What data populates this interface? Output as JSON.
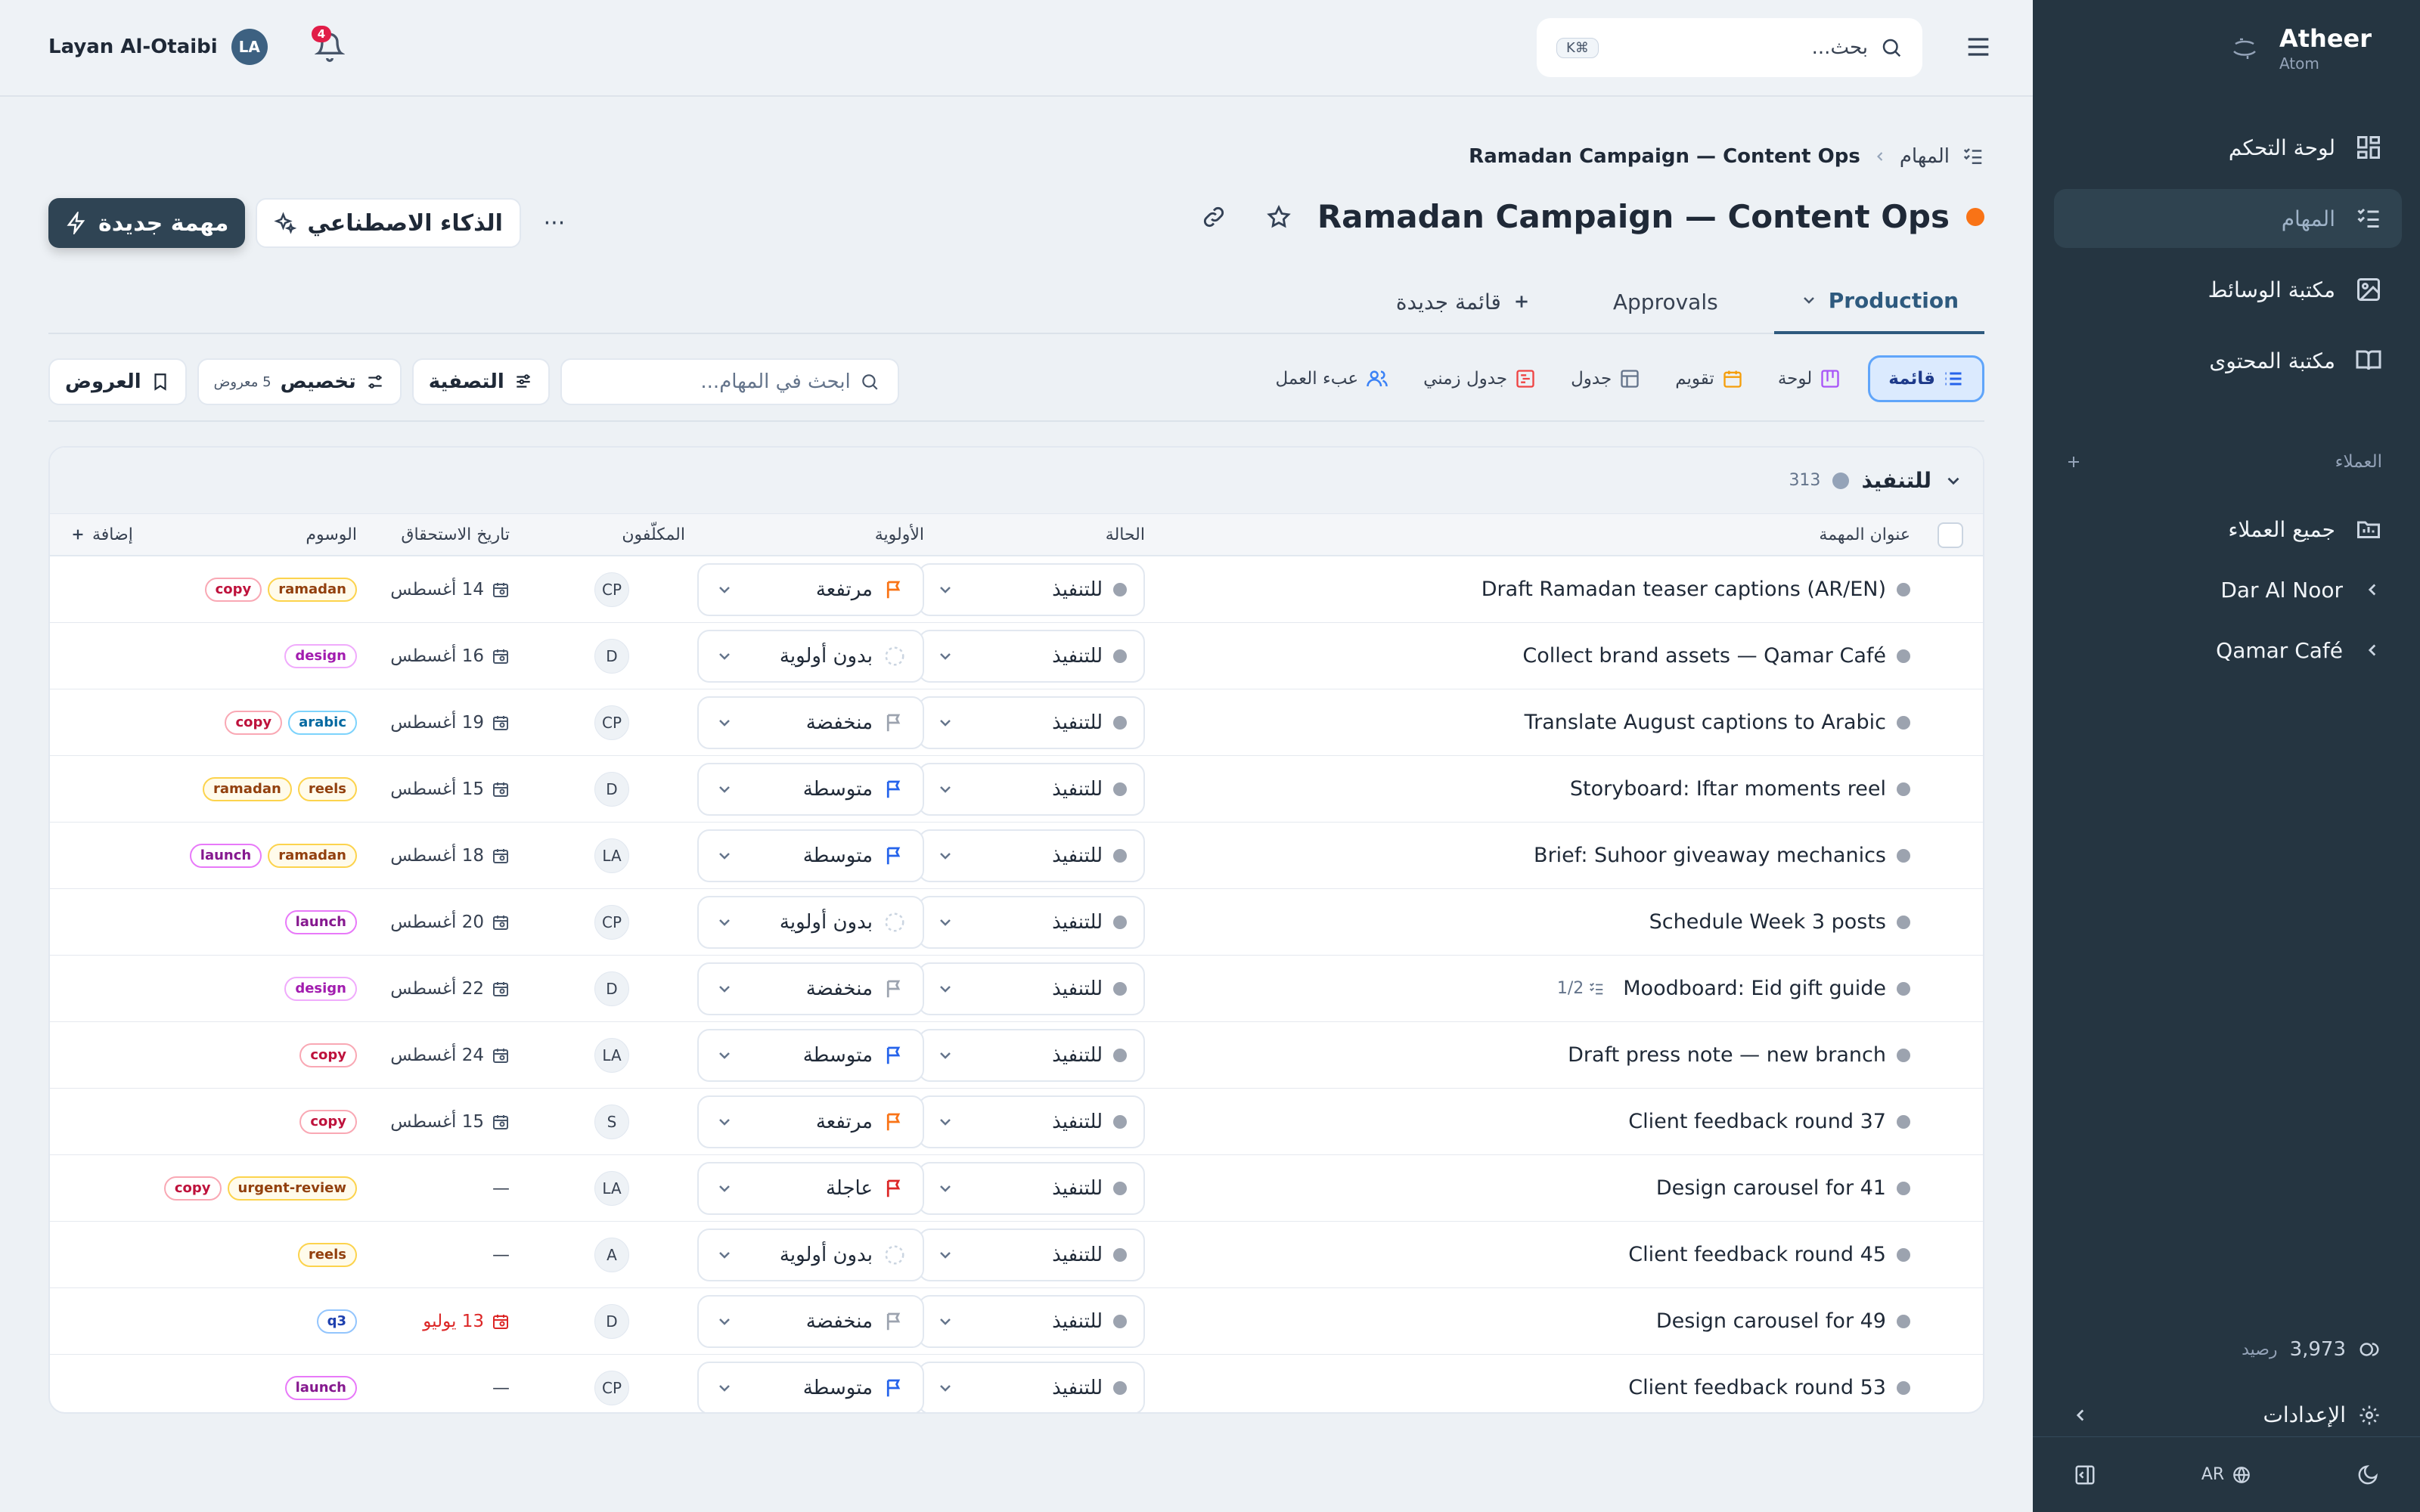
{
  "sidebar": {
    "brand": "Atheer",
    "brand_sub": "Atom",
    "items": [
      {
        "label": "لوحة التحكم"
      },
      {
        "label": "المهام"
      },
      {
        "label": "مكتبة الوسائط"
      },
      {
        "label": "مكتبة المحتوى"
      }
    ],
    "clients_heading": "العملاء",
    "clients": [
      {
        "label": "جميع العملاء"
      },
      {
        "label": "Dar Al Noor"
      },
      {
        "label": "Qamar Café"
      }
    ],
    "credits_value": "3,973",
    "credits_label": "رصيد",
    "settings_label": "الإعدادات",
    "lang": "AR"
  },
  "topbar": {
    "search_placeholder": "بحث...",
    "search_kbd": "⌘K",
    "user_name": "Layan Al-Otaibi",
    "user_initials": "LA",
    "notif_count": "4"
  },
  "breadcrumb": {
    "root": "المهام",
    "current": "Ramadan Campaign — Content Ops"
  },
  "page": {
    "title": "Ramadan Campaign — Content Ops",
    "new_task": "مهمة جديدة",
    "ai": "الذكاء الاصطناعي",
    "more": "···"
  },
  "tabs": [
    {
      "label": "Production"
    },
    {
      "label": "Approvals"
    },
    {
      "label": "قائمة جديدة"
    }
  ],
  "views": [
    {
      "label": "قائمة"
    },
    {
      "label": "لوحة"
    },
    {
      "label": "تقويم"
    },
    {
      "label": "جدول"
    },
    {
      "label": "جدول زمني"
    },
    {
      "label": "عبء العمل"
    }
  ],
  "toolbar": {
    "search_placeholder": "ابحث في المهام...",
    "filter": "التصفية",
    "customize": "تخصيص",
    "customize_count": "5 معروض",
    "views": "العروض"
  },
  "group": {
    "name": "للتنفيذ",
    "count": "313"
  },
  "columns": {
    "title": "عنوان المهمة",
    "status": "الحالة",
    "priority": "الأولوية",
    "assignees": "المكلّفون",
    "due": "تاريخ الاستحقاق",
    "tags": "الوسوم",
    "add": "إضافة"
  },
  "colors": {
    "high": "#f97316",
    "none": "#cbd5e1",
    "low": "#9ca3af",
    "medium": "#2563eb",
    "urgent": "#dc2626"
  },
  "rows": [
    {
      "title": "Draft Ramadan teaser captions (AR/EN)",
      "status": "للتنفيذ",
      "priority": "مرتفعة",
      "p": "high",
      "assignee": "CP",
      "due": "14 أغسطس",
      "tags": [
        "ramadan",
        "copy"
      ]
    },
    {
      "title": "Collect brand assets — Qamar Café",
      "status": "للتنفيذ",
      "priority": "بدون أولوية",
      "p": "none",
      "assignee": "D",
      "due": "16 أغسطس",
      "tags": [
        "design"
      ]
    },
    {
      "title": "Translate August captions to Arabic",
      "status": "للتنفيذ",
      "priority": "منخفضة",
      "p": "low",
      "assignee": "CP",
      "due": "19 أغسطس",
      "tags": [
        "arabic",
        "copy"
      ]
    },
    {
      "title": "Storyboard: Iftar moments reel",
      "status": "للتنفيذ",
      "priority": "متوسطة",
      "p": "medium",
      "assignee": "D",
      "due": "15 أغسطس",
      "tags": [
        "reels",
        "ramadan"
      ]
    },
    {
      "title": "Brief: Suhoor giveaway mechanics",
      "status": "للتنفيذ",
      "priority": "متوسطة",
      "p": "medium",
      "assignee": "LA",
      "due": "18 أغسطس",
      "tags": [
        "ramadan",
        "launch"
      ]
    },
    {
      "title": "Schedule Week 3 posts",
      "status": "للتنفيذ",
      "priority": "بدون أولوية",
      "p": "none",
      "assignee": "CP",
      "due": "20 أغسطس",
      "tags": [
        "launch"
      ]
    },
    {
      "title": "Moodboard: Eid gift guide",
      "subtasks": "1/2",
      "status": "للتنفيذ",
      "priority": "منخفضة",
      "p": "low",
      "assignee": "D",
      "due": "22 أغسطس",
      "tags": [
        "design"
      ]
    },
    {
      "title": "Draft press note — new branch",
      "status": "للتنفيذ",
      "priority": "متوسطة",
      "p": "medium",
      "assignee": "LA",
      "due": "24 أغسطس",
      "tags": [
        "copy"
      ]
    },
    {
      "title": "Client feedback round 37",
      "status": "للتنفيذ",
      "priority": "مرتفعة",
      "p": "high",
      "assignee": "S",
      "due": "15 أغسطس",
      "tags": [
        "copy"
      ]
    },
    {
      "title": "Design carousel for 41",
      "status": "للتنفيذ",
      "priority": "عاجلة",
      "p": "urgent",
      "assignee": "LA",
      "due": "—",
      "tags": [
        "urgent-review",
        "copy"
      ]
    },
    {
      "title": "Client feedback round 45",
      "status": "للتنفيذ",
      "priority": "بدون أولوية",
      "p": "none",
      "assignee": "A",
      "due": "—",
      "tags": [
        "reels"
      ]
    },
    {
      "title": "Design carousel for 49",
      "status": "للتنفيذ",
      "priority": "منخفضة",
      "p": "low",
      "assignee": "D",
      "due": "13 يوليو",
      "overdue": true,
      "tags": [
        "q3"
      ]
    },
    {
      "title": "Client feedback round 53",
      "status": "للتنفيذ",
      "priority": "متوسطة",
      "p": "medium",
      "assignee": "CP",
      "due": "—",
      "tags": [
        "launch"
      ]
    }
  ]
}
